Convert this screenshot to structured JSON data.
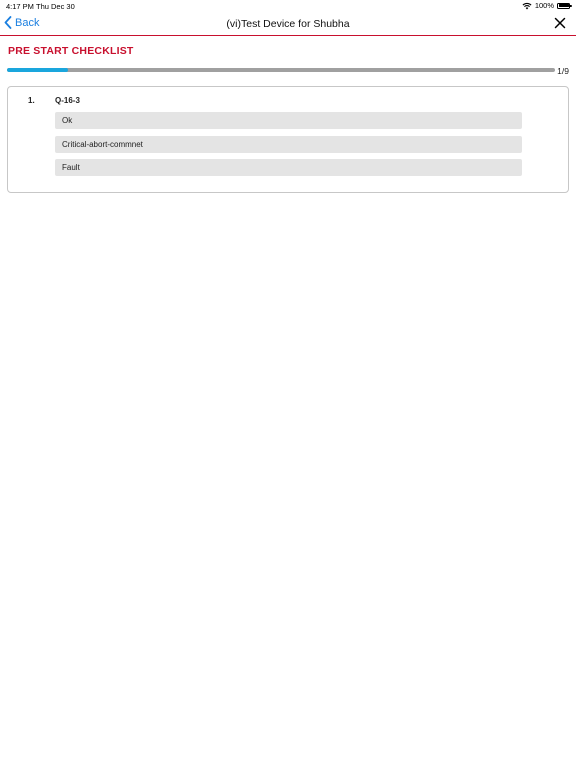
{
  "status_bar": {
    "time": "4:17 PM",
    "date": "Thu Dec 30",
    "battery": "100%",
    "icons": [
      "wifi-icon",
      "battery-icon"
    ]
  },
  "nav": {
    "back_label": "Back",
    "title": "(vi)Test Device for Shubha",
    "icons": [
      "chevron-left-icon",
      "close-icon"
    ]
  },
  "checklist": {
    "title": "PRE START CHECKLIST",
    "progress_current": 1,
    "progress_total": 9,
    "progress_label": "1/9"
  },
  "question": {
    "number": "1.",
    "text": "Q-16-3",
    "options": [
      {
        "label": "Ok"
      },
      {
        "label": "Critical-abort-commnet"
      },
      {
        "label": "Fault"
      }
    ]
  },
  "colors": {
    "accent_red": "#c8102e",
    "link_blue": "#1a7fe0",
    "progress_blue": "#1aa6dd"
  }
}
